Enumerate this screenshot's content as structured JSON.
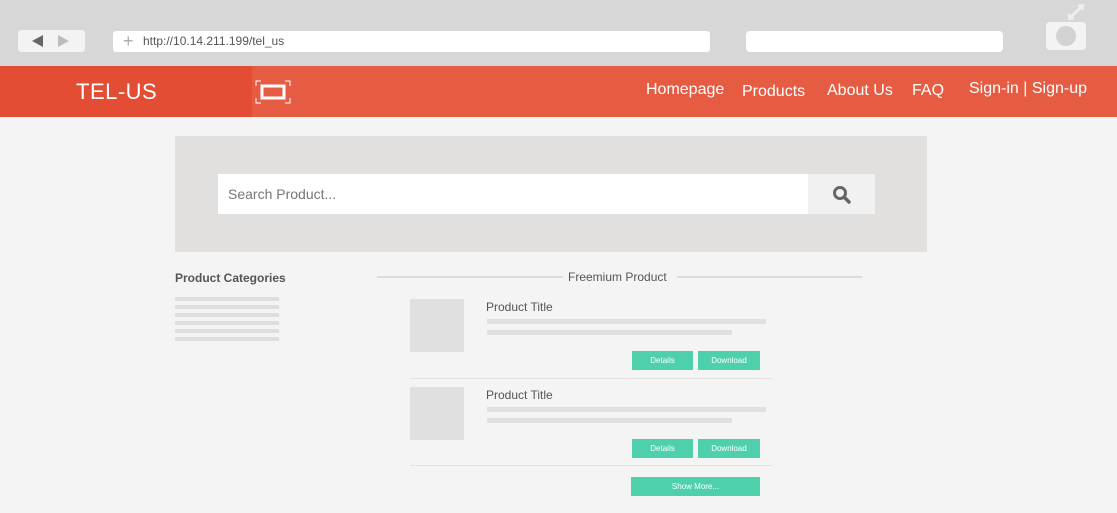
{
  "browser": {
    "url": "http://10.14.211.199/tel_us",
    "icons": {
      "back": "triangle-left-icon",
      "forward": "triangle-right-icon",
      "new_tab": "plus-icon",
      "menu": "circle-menu-icon",
      "fullscreen": "expand-arrows-icon"
    }
  },
  "header": {
    "logo": "TEL-US",
    "screen_icon": "screen-frame-icon",
    "nav": [
      "Homepage",
      "Products",
      "About Us",
      "FAQ",
      "Sign-in | Sign-up"
    ],
    "colors": {
      "bar": "#e65c43",
      "logo_block": "#e24d34"
    }
  },
  "search": {
    "placeholder": "Search Product...",
    "button_icon": "magnifier-icon"
  },
  "sidebar": {
    "title": "Product Categories"
  },
  "freemium": {
    "title": "Freemium Product",
    "products": [
      {
        "title": "Product Title",
        "details_label": "Details",
        "download_label": "Download"
      },
      {
        "title": "Product Title",
        "details_label": "Details",
        "download_label": "Download"
      }
    ],
    "show_more_label": "Show More...",
    "accent": "#4fd0ad"
  }
}
